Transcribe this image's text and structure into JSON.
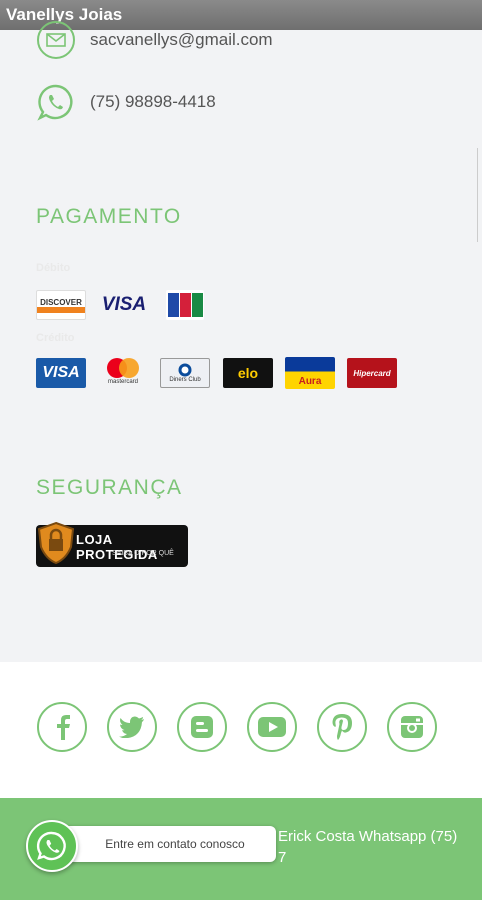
{
  "window": {
    "title": "Vanellys Joias"
  },
  "contact": {
    "email": "sacvanellys@gmail.com",
    "phone": "(75) 98898-4418",
    "email_icon": "envelope-icon",
    "phone_icon": "whatsapp-icon"
  },
  "payment": {
    "title": "PAGAMENTO",
    "debit_label": "Débito",
    "credit_label": "Crédito",
    "debit_cards": [
      {
        "name": "Discover",
        "text": "DISCOVER"
      },
      {
        "name": "Visa Electron",
        "text": "VISA"
      },
      {
        "name": "JCB",
        "text": "JCB"
      }
    ],
    "credit_cards": [
      {
        "name": "Visa",
        "text": "VISA"
      },
      {
        "name": "Mastercard",
        "text": "mastercard"
      },
      {
        "name": "Diners Club",
        "text": "Diners Club"
      },
      {
        "name": "Elo",
        "text": "elo"
      },
      {
        "name": "Aura",
        "text": "Aura"
      },
      {
        "name": "Hipercard",
        "text": "Hipercard"
      }
    ]
  },
  "security": {
    "title": "SEGURANÇA",
    "badge_title": "LOJA PROTEGIDA",
    "badge_subtitle": "SAIBA O POR QUÊ"
  },
  "social": [
    "facebook-icon",
    "twitter-icon",
    "blogger-icon",
    "youtube-icon",
    "pinterest-icon",
    "instagram-icon"
  ],
  "footer": {
    "text_line1": "Erick Costa Whatsapp (75)",
    "text_line2": "7"
  },
  "whatsapp_widget": {
    "label": "Entre em contato conosco"
  },
  "colors": {
    "accent": "#7cc576",
    "titlebar": "#7a7a7a",
    "background": "#f2f3f5"
  }
}
